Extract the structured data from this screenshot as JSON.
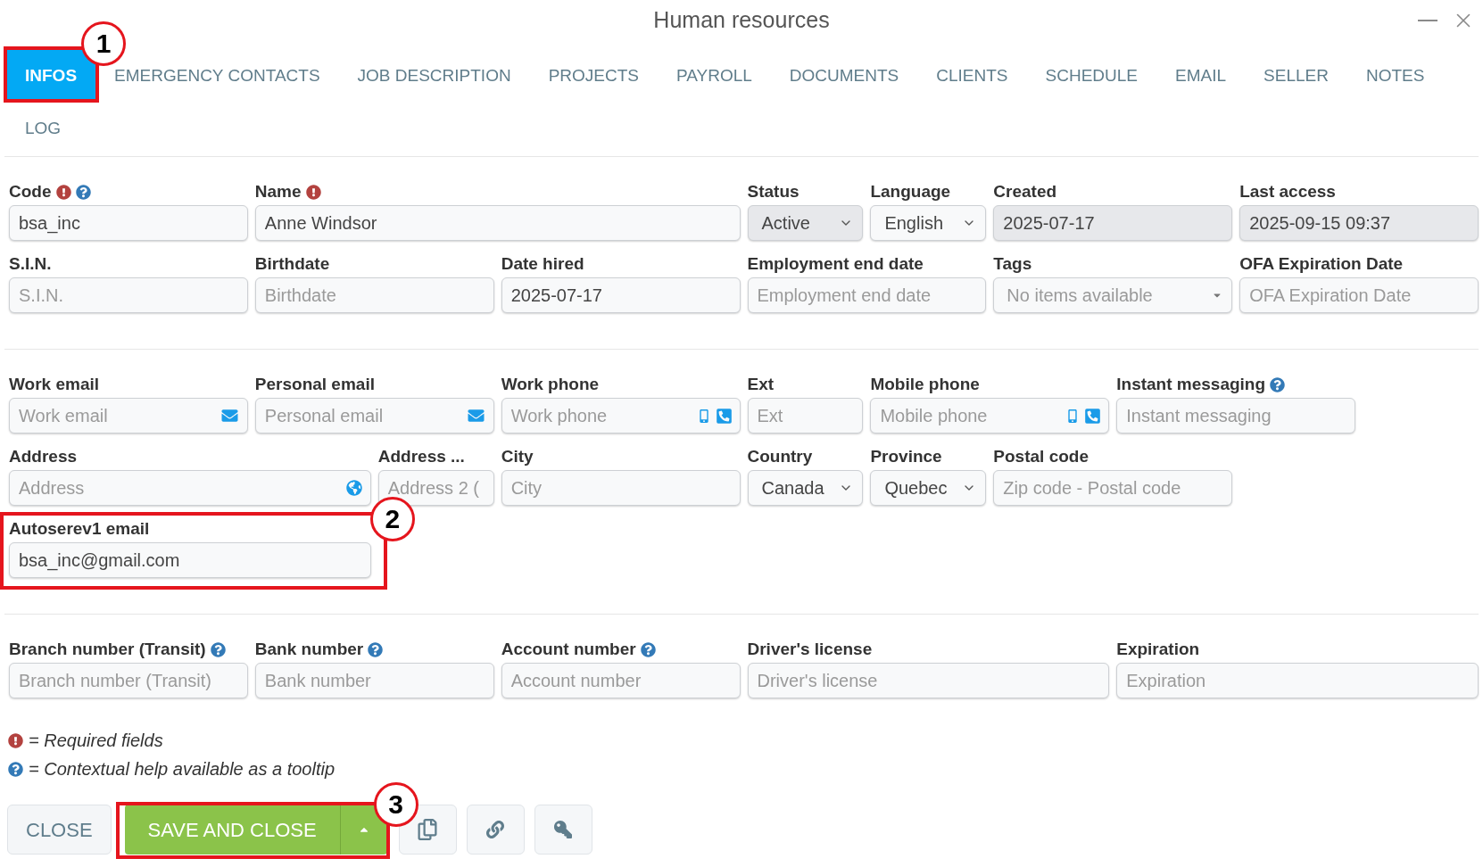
{
  "window": {
    "title": "Human resources"
  },
  "tabs": [
    {
      "label": "INFOS",
      "selected": true,
      "callout": "1"
    },
    {
      "label": "EMERGENCY CONTACTS",
      "selected": false
    },
    {
      "label": "JOB DESCRIPTION",
      "selected": false
    },
    {
      "label": "PROJECTS",
      "selected": false
    },
    {
      "label": "PAYROLL",
      "selected": false
    },
    {
      "label": "DOCUMENTS",
      "selected": false
    },
    {
      "label": "CLIENTS",
      "selected": false
    },
    {
      "label": "SCHEDULE",
      "selected": false
    },
    {
      "label": "EMAIL",
      "selected": false
    },
    {
      "label": "SELLER",
      "selected": false
    },
    {
      "label": "NOTES",
      "selected": false
    },
    {
      "label": "LOG",
      "selected": false
    }
  ],
  "sections": [
    {
      "rows": [
        {
          "fields": [
            {
              "label": "Code",
              "kind": "text",
              "value": "bsa_inc",
              "required": true,
              "help": true,
              "disabled": false
            },
            {
              "label": "Name",
              "kind": "text",
              "value": "Anne Windsor",
              "required": true,
              "help": false,
              "disabled": false
            },
            {
              "label": "Status",
              "kind": "select",
              "value": "Active",
              "required": false,
              "help": false,
              "disabled": true
            },
            {
              "label": "Language",
              "kind": "select",
              "value": "English",
              "required": false,
              "help": false,
              "disabled": false
            },
            {
              "label": "Created",
              "kind": "text",
              "value": "2025-07-17",
              "required": false,
              "help": false,
              "disabled": true
            },
            {
              "label": "Last access",
              "kind": "text",
              "value": "2025-09-15 09:37",
              "required": false,
              "help": false,
              "disabled": true
            }
          ]
        },
        {
          "fields": [
            {
              "label": "S.I.N.",
              "kind": "text",
              "placeholder": "S.I.N.",
              "required": false,
              "help": false,
              "disabled": false
            },
            {
              "label": "Birthdate",
              "kind": "text",
              "placeholder": "Birthdate",
              "required": false,
              "help": false,
              "disabled": false
            },
            {
              "label": "Date hired",
              "kind": "text",
              "value": "2025-07-17",
              "required": false,
              "help": false,
              "disabled": false
            },
            {
              "label": "Employment end date",
              "kind": "text",
              "placeholder": "Employment end date",
              "required": false,
              "help": false,
              "disabled": false
            },
            {
              "label": "Tags",
              "kind": "tags",
              "placeholder": "No items available",
              "required": false,
              "help": false,
              "disabled": false
            },
            {
              "label": "OFA Expiration Date",
              "kind": "text",
              "placeholder": "OFA Expiration Date",
              "required": false,
              "help": false,
              "disabled": false
            }
          ]
        }
      ]
    },
    {
      "rows": [
        {
          "fields": [
            {
              "label": "Work email",
              "kind": "email",
              "placeholder": "Work email",
              "required": false,
              "help": false,
              "disabled": false
            },
            {
              "label": "Personal email",
              "kind": "email",
              "placeholder": "Personal email",
              "required": false,
              "help": false,
              "disabled": false
            },
            {
              "label": "Work phone",
              "kind": "phone",
              "placeholder": "Work phone",
              "required": false,
              "help": false,
              "disabled": false
            },
            {
              "label": "Ext",
              "kind": "text",
              "placeholder": "Ext",
              "required": false,
              "help": false,
              "disabled": false
            },
            {
              "label": "Mobile phone",
              "kind": "phone",
              "placeholder": "Mobile phone",
              "required": false,
              "help": false,
              "disabled": false
            },
            {
              "label": "Instant messaging",
              "kind": "text",
              "placeholder": "Instant messaging",
              "required": false,
              "help": true,
              "disabled": false
            }
          ]
        },
        {
          "fields": [
            {
              "label": "Address",
              "kind": "address",
              "placeholder": "Address",
              "required": false,
              "help": false,
              "disabled": false
            },
            {
              "label": "Address ...",
              "kind": "text",
              "placeholder": "Address 2 (",
              "required": false,
              "help": false,
              "disabled": false
            },
            {
              "label": "City",
              "kind": "text",
              "placeholder": "City",
              "required": false,
              "help": false,
              "disabled": false
            },
            {
              "label": "Country",
              "kind": "select",
              "value": "Canada",
              "required": false,
              "help": false,
              "disabled": false
            },
            {
              "label": "Province",
              "kind": "select",
              "value": "Quebec",
              "required": false,
              "help": false,
              "disabled": false
            },
            {
              "label": "Postal code",
              "kind": "text",
              "placeholder": "Zip code - Postal code",
              "required": false,
              "help": false,
              "disabled": false
            }
          ]
        },
        {
          "fields": [
            {
              "label": "Autoserev1 email",
              "kind": "text",
              "value": "bsa_inc@gmail.com",
              "required": false,
              "help": false,
              "disabled": false,
              "callout": "2"
            }
          ]
        }
      ]
    },
    {
      "rows": [
        {
          "fields": [
            {
              "label": "Branch number (Transit)",
              "kind": "text",
              "placeholder": "Branch number (Transit)",
              "required": false,
              "help": true,
              "disabled": false
            },
            {
              "label": "Bank number",
              "kind": "text",
              "placeholder": "Bank number",
              "required": false,
              "help": true,
              "disabled": false
            },
            {
              "label": "Account number",
              "kind": "text",
              "placeholder": "Account number",
              "required": false,
              "help": true,
              "disabled": false
            },
            {
              "label": "Driver's license",
              "kind": "text",
              "placeholder": "Driver's license",
              "required": false,
              "help": false,
              "disabled": false
            },
            {
              "label": "Expiration",
              "kind": "text",
              "placeholder": "Expiration",
              "required": false,
              "help": false,
              "disabled": false
            }
          ]
        }
      ]
    }
  ],
  "legend": [
    {
      "kind": "required",
      "text": "= Required fields"
    },
    {
      "kind": "help",
      "text": "= Contextual help available as a tooltip"
    }
  ],
  "buttons": [
    {
      "kind": "plain",
      "label": "CLOSE"
    },
    {
      "kind": "primary_split",
      "label": "SAVE AND CLOSE",
      "callout": "3"
    }
  ]
}
